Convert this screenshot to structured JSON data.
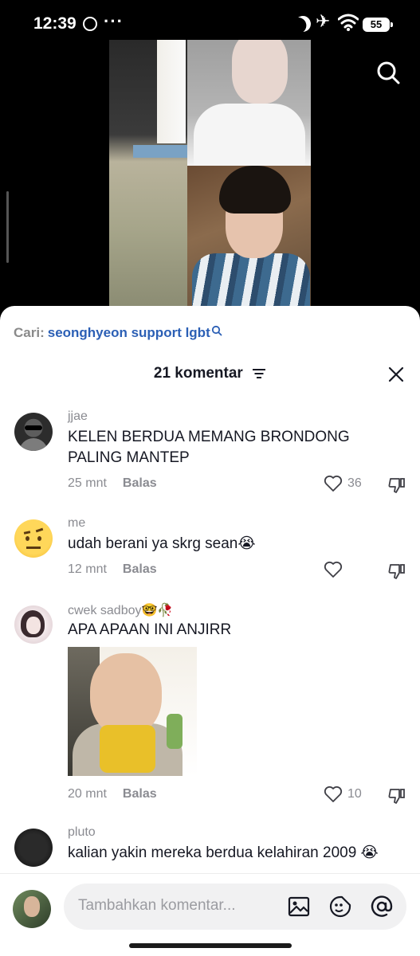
{
  "status_bar": {
    "time": "12:39",
    "dots": "···",
    "battery": "55"
  },
  "search_bar": {
    "label": "Cari:",
    "query": "seonghyeon support lgbt"
  },
  "comments_header": {
    "title": "21 komentar"
  },
  "comments": [
    {
      "username": "jjae",
      "text": "KELEN BERDUA MEMANG BRONDONG PALING MANTEP",
      "time": "25 mnt",
      "reply_label": "Balas",
      "likes": "36"
    },
    {
      "username": "me",
      "text": "udah berani ya skrg sean😭",
      "time": "12 mnt",
      "reply_label": "Balas",
      "likes": ""
    },
    {
      "username": "cwek sadboy🤓🥀",
      "text": "APA APAAN INI ANJIRR",
      "time": "20 mnt",
      "reply_label": "Balas",
      "likes": "10"
    },
    {
      "username": "pluto",
      "text": "kalian yakin mereka berdua kelahiran 2009 😭"
    }
  ],
  "input": {
    "placeholder": "Tambahkan komentar..."
  },
  "icons": [
    "search-icon",
    "sort-icon",
    "close-icon",
    "heart-icon",
    "dislike-icon",
    "image-icon",
    "emoji-icon",
    "mention-icon"
  ]
}
